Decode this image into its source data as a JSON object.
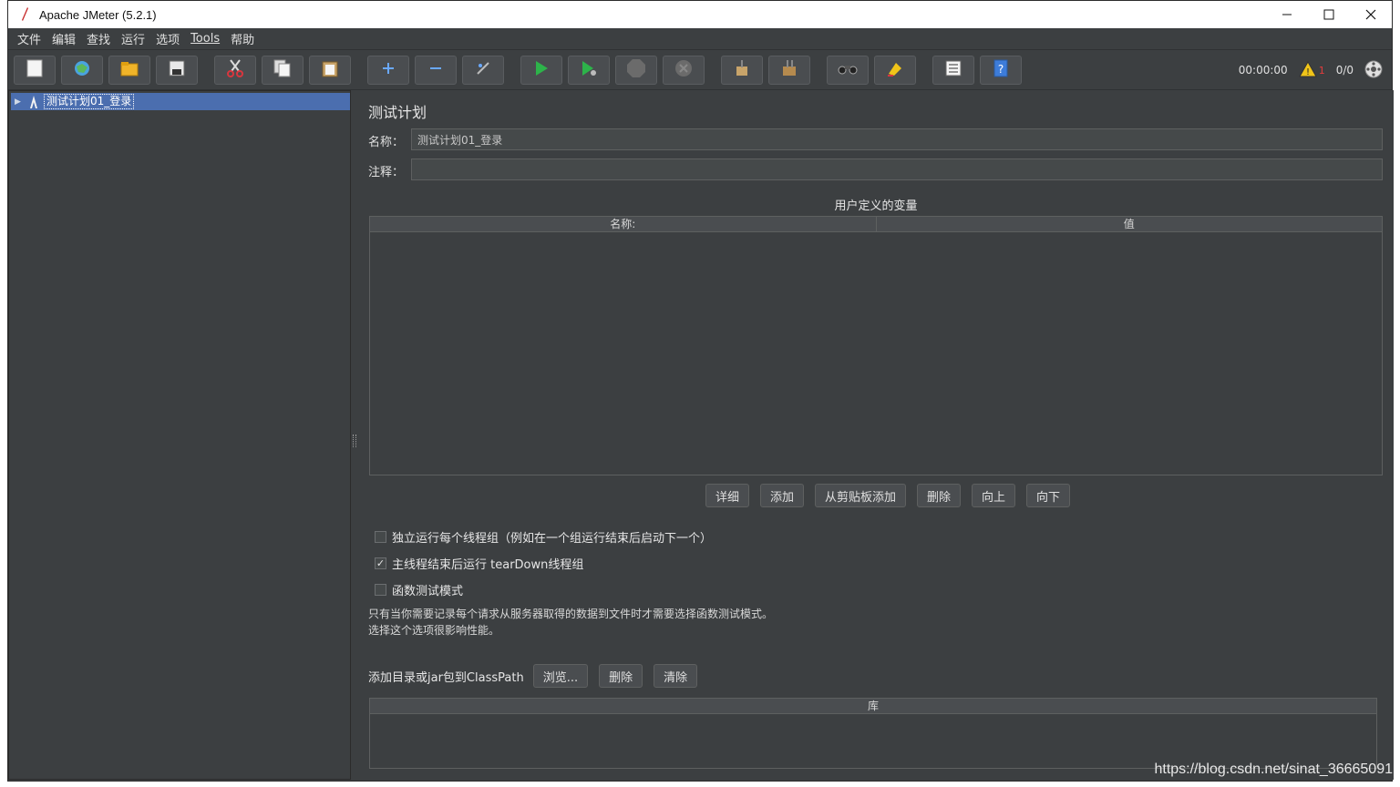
{
  "window": {
    "title": "Apache JMeter (5.2.1)"
  },
  "menu": [
    {
      "label": "文件"
    },
    {
      "label": "编辑"
    },
    {
      "label": "查找"
    },
    {
      "label": "运行"
    },
    {
      "label": "选项"
    },
    {
      "label": "Tools"
    },
    {
      "label": "帮助"
    }
  ],
  "toolbar": {
    "icons": [
      "new-icon",
      "templates-icon",
      "open-icon",
      "save-icon",
      "cut-icon",
      "copy-icon",
      "paste-icon",
      "expand-icon",
      "collapse-icon",
      "toggle-icon",
      "start-icon",
      "start-no-pause-icon",
      "stop-icon",
      "shutdown-icon",
      "clear-icon",
      "clear-all-icon",
      "search-icon",
      "reset-search-icon",
      "function-helper-icon",
      "help-icon"
    ],
    "timer": "00:00:00",
    "warning_count": "1",
    "threads": "0/0"
  },
  "tree": {
    "root_label": "测试计划01_登录"
  },
  "panel": {
    "title": "测试计划",
    "name_label": "名称：",
    "name_value": "测试计划01_登录",
    "comment_label": "注释：",
    "comment_value": "",
    "vars_caption": "用户定义的变量",
    "vars_columns": [
      "名称:",
      "值"
    ],
    "buttons": [
      "详细",
      "添加",
      "从剪贴板添加",
      "删除",
      "向上",
      "向下"
    ],
    "options": [
      {
        "label": "独立运行每个线程组（例如在一个组运行结束后启动下一个）",
        "checked": false
      },
      {
        "label": "主线程结束后运行 tearDown线程组",
        "checked": true
      },
      {
        "label": "函数测试模式",
        "checked": false
      }
    ],
    "note_line1": "只有当你需要记录每个请求从服务器取得的数据到文件时才需要选择函数测试模式。",
    "note_line2": "选择这个选项很影响性能。",
    "classpath_label": "添加目录或jar包到ClassPath",
    "classpath_buttons": [
      "浏览...",
      "删除",
      "清除"
    ],
    "lib_column": "库"
  },
  "watermark": "https://blog.csdn.net/sinat_36665091"
}
